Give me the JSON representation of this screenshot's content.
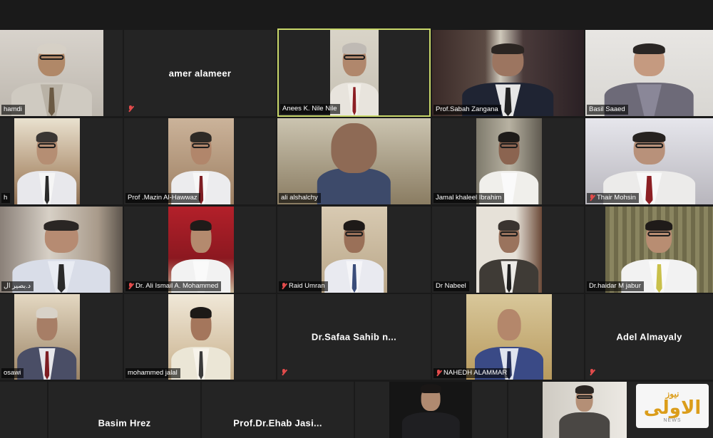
{
  "participants": [
    {
      "name": "hamdi",
      "display": "video",
      "muted": false
    },
    {
      "name": "amer alameer",
      "display": "name",
      "muted": true
    },
    {
      "name": "Anees K. Nile Nile",
      "display": "video",
      "muted": false,
      "active_speaker": true
    },
    {
      "name": "Prof.Sabah Zangana",
      "display": "video",
      "muted": false
    },
    {
      "name": "Basil Saaed",
      "display": "video",
      "muted": false
    },
    {
      "name": "h",
      "display": "video",
      "muted": false
    },
    {
      "name": "Prof .Mazin Al-Hawwaz",
      "display": "video",
      "muted": false
    },
    {
      "name": "ali alshalchy",
      "display": "video",
      "muted": false
    },
    {
      "name": "Jamal khaleel Ibrahim",
      "display": "video",
      "muted": false
    },
    {
      "name": "Thair Mohsin",
      "display": "video",
      "muted": true
    },
    {
      "name": "د.بصير ال",
      "display": "video",
      "muted": false
    },
    {
      "name": "Dr. Ali Ismail A. Mohammed",
      "display": "video",
      "muted": true
    },
    {
      "name": "Raid Umran",
      "display": "video",
      "muted": true
    },
    {
      "name": "Dr Nabeel",
      "display": "video",
      "muted": false
    },
    {
      "name": "Dr.haidar M jabur",
      "display": "video",
      "muted": false
    },
    {
      "name": "osawi",
      "display": "video",
      "muted": false
    },
    {
      "name": "mohammed jalal",
      "display": "video",
      "muted": false
    },
    {
      "name": "Dr.Safaa Sahib n...",
      "display": "name",
      "muted": true
    },
    {
      "name": "NAHEDH ALAMMAR",
      "display": "video",
      "muted": true
    },
    {
      "name": "Adel Almayaly",
      "display": "name",
      "muted": true
    },
    {
      "name": "",
      "display": "blank",
      "muted": false
    },
    {
      "name": "Basim Hrez",
      "display": "name",
      "muted": false
    },
    {
      "name": "Prof.Dr.Ehab Jasi...",
      "display": "name",
      "muted": false
    },
    {
      "name": "",
      "display": "video",
      "muted": false
    },
    {
      "name": "",
      "display": "video",
      "muted": false
    }
  ],
  "watermark": {
    "arabic": "الاولى",
    "arabic_small": "نيوز",
    "latin": "NEWS"
  },
  "colors": {
    "background": "#1a1a1a",
    "tile": "#242424",
    "active_border": "#c9d86a",
    "mute": "#e24b4b",
    "logo": "#e3a21a"
  }
}
